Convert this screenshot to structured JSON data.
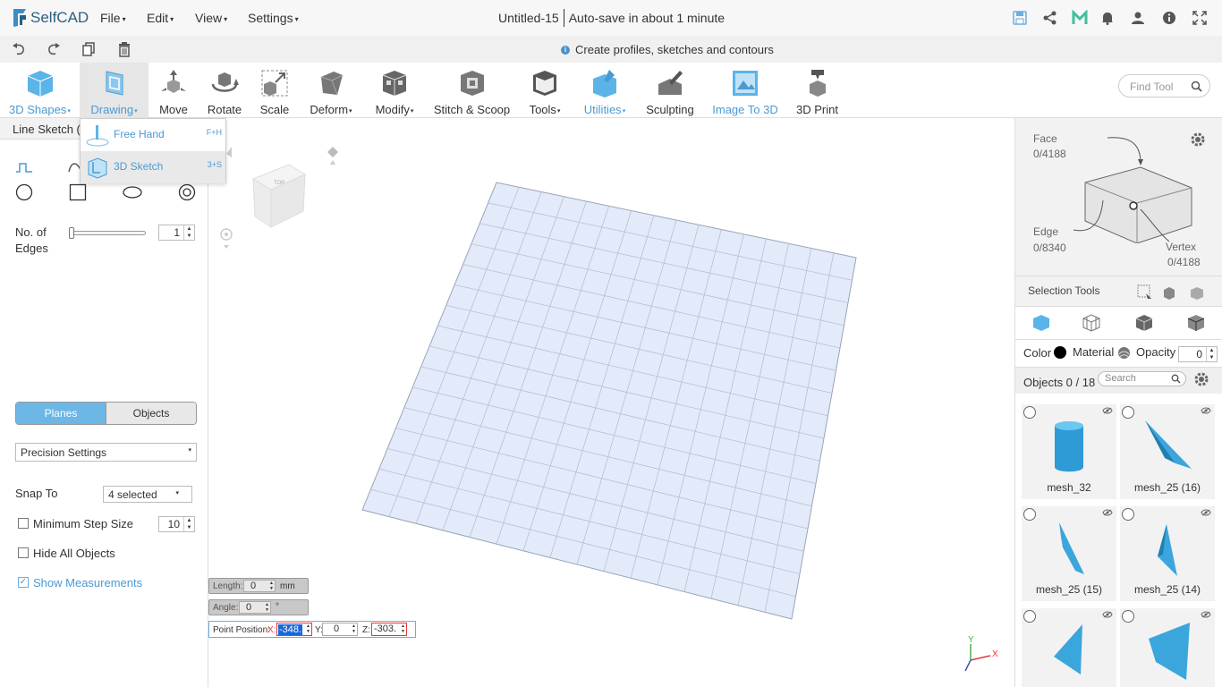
{
  "app": {
    "name": "SelfCAD"
  },
  "menu": [
    {
      "label": "File"
    },
    {
      "label": "Edit"
    },
    {
      "label": "View"
    },
    {
      "label": "Settings"
    }
  ],
  "document": {
    "title": "Untitled-15",
    "autosave": "Auto-save in about 1 minute"
  },
  "hint": "Create profiles, sketches and contours",
  "toolbar": {
    "tools": [
      {
        "label": "3D Shapes",
        "dropdown": true,
        "highlight": true
      },
      {
        "label": "Drawing",
        "dropdown": true,
        "highlight": true
      },
      {
        "label": "Move"
      },
      {
        "label": "Rotate"
      },
      {
        "label": "Scale"
      },
      {
        "label": "Deform",
        "dropdown": true
      },
      {
        "label": "Modify",
        "dropdown": true
      },
      {
        "label": "Stitch & Scoop"
      },
      {
        "label": "Tools",
        "dropdown": true
      },
      {
        "label": "Utilities",
        "dropdown": true,
        "highlight": true
      },
      {
        "label": "Sculpting"
      },
      {
        "label": "Image To 3D",
        "highlight": true
      },
      {
        "label": "3D Print"
      }
    ],
    "find_placeholder": "Find Tool"
  },
  "drawing_menu": {
    "items": [
      {
        "label": "Free Hand",
        "shortcut": "F+H"
      },
      {
        "label": "3D Sketch",
        "shortcut": "3+S"
      }
    ]
  },
  "left_panel": {
    "title": "Line Sketch (3",
    "edges_label_1": "No. of",
    "edges_label_2": "Edges",
    "edges_value": "1",
    "planes_label": "Planes",
    "objects_label": "Objects",
    "precision_label": "Precision Settings",
    "snap_label": "Snap To",
    "snap_value": "4 selected",
    "min_step_label": "Minimum Step Size",
    "min_step_value": "10",
    "hide_all_label": "Hide All Objects",
    "show_measurements_label": "Show Measurements",
    "checkbox_check": "✓"
  },
  "viewcube": {
    "top": "TOP"
  },
  "coords": {
    "length_label": "Length:",
    "length_value": "0",
    "length_unit": "mm",
    "angle_label": "Angle:",
    "angle_value": "0",
    "angle_unit": "°",
    "point_label": "Point Position:",
    "x_label": "X:",
    "x_value": "-348.",
    "y_label": "Y:",
    "y_value": "0",
    "z_label": "Z:",
    "z_value": "-303."
  },
  "axis": {
    "y": "Y",
    "x": "X"
  },
  "right_panel": {
    "face_label": "Face",
    "face_value": "0/4188",
    "edge_label": "Edge",
    "edge_value": "0/8340",
    "vertex_label": "Vertex",
    "vertex_value": "0/4188",
    "selection_tools_label": "Selection Tools",
    "color_label": "Color",
    "material_label": "Material",
    "opacity_label": "Opacity",
    "opacity_value": "0",
    "objects_count": "Objects 0 / 18",
    "search_placeholder": "Search"
  },
  "objects": [
    {
      "name": "mesh_32"
    },
    {
      "name": "mesh_25 (16)"
    },
    {
      "name": "mesh_25 (15)"
    },
    {
      "name": "mesh_25 (14)"
    },
    {
      "name": ""
    },
    {
      "name": ""
    }
  ],
  "colors": {
    "accent": "#4a9ad4",
    "grid_fill": "#e3ebfb",
    "grid_line": "#b7c0cf",
    "object_blue": "#3aa6dc"
  }
}
